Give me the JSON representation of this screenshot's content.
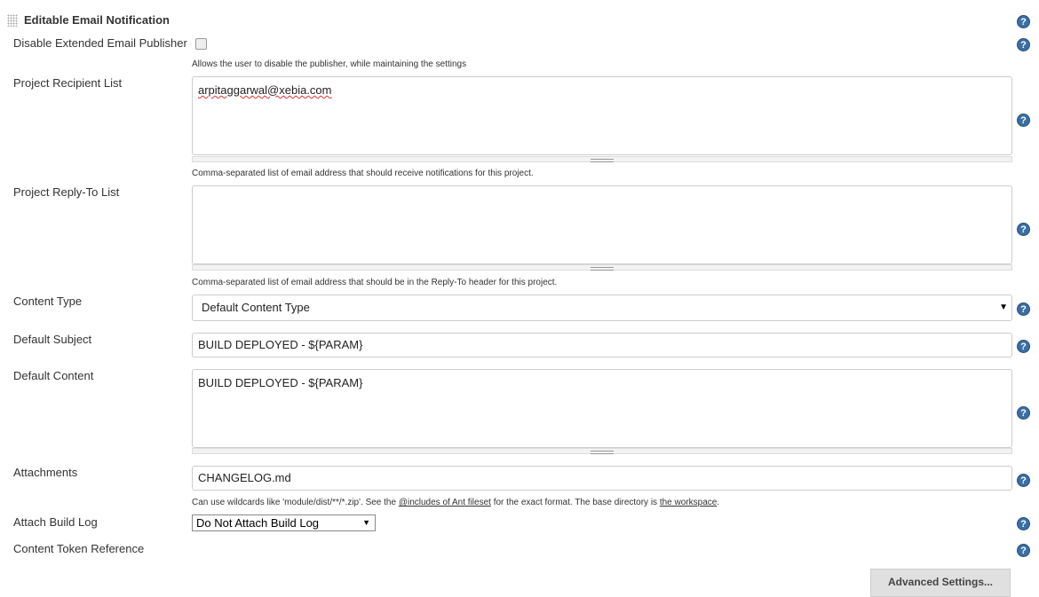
{
  "section": {
    "title": "Editable Email Notification"
  },
  "disable": {
    "label": "Disable Extended Email Publisher",
    "checked": false,
    "description": "Allows the user to disable the publisher, while maintaining the settings"
  },
  "recipients": {
    "label": "Project Recipient List",
    "value": "arpitaggarwal@xebia.com",
    "description": "Comma-separated list of email address that should receive notifications for this project."
  },
  "reply_to": {
    "label": "Project Reply-To List",
    "value": "",
    "description": "Comma-separated list of email address that should be in the Reply-To header for this project."
  },
  "content_type": {
    "label": "Content Type",
    "value": "Default Content Type"
  },
  "subject": {
    "label": "Default Subject",
    "value": "BUILD DEPLOYED - ${PARAM}"
  },
  "content": {
    "label": "Default Content",
    "value": "BUILD DEPLOYED - ${PARAM}"
  },
  "attachments": {
    "label": "Attachments",
    "value": "CHANGELOG.md",
    "desc_pre": "Can use wildcards like 'module/dist/**/*.zip'. See the ",
    "desc_link1": "@includes of Ant fileset",
    "desc_mid": " for the exact format. The base directory is ",
    "desc_link2": "the workspace",
    "desc_post": "."
  },
  "build_log": {
    "label": "Attach Build Log",
    "value": "Do Not Attach Build Log"
  },
  "token_ref": {
    "label": "Content Token Reference"
  },
  "advanced_button": "Advanced Settings...",
  "help_glyph": "?",
  "dropdown_arrow": "▼"
}
